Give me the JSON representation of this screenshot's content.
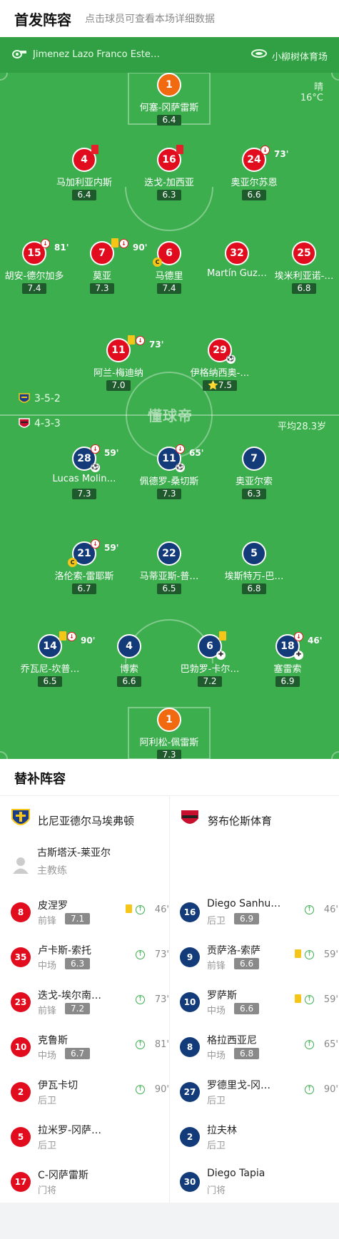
{
  "header": {
    "title": "首发阵容",
    "subtitle": "点击球员可查看本场详细数据"
  },
  "match": {
    "referee": "Jimenez Lazo Franco Este…",
    "venue": "小柳树体育场",
    "weather": "晴",
    "temperature": "16°C"
  },
  "home": {
    "formation": "3-5-2",
    "players": [
      {
        "num": "1",
        "name": "何塞-冈萨雷斯",
        "rating": "6.4"
      },
      {
        "num": "4",
        "name": "马加利亚内斯",
        "rating": "6.4"
      },
      {
        "num": "16",
        "name": "迭戈-加西亚",
        "rating": "6.3"
      },
      {
        "num": "24",
        "name": "奥亚尔苏恩",
        "rating": "6.6",
        "sub_time": "73'"
      },
      {
        "num": "15",
        "name": "胡安-德尔加多",
        "rating": "7.4",
        "sub_time": "81'"
      },
      {
        "num": "7",
        "name": "莫亚",
        "rating": "7.3",
        "sub_time": "90'"
      },
      {
        "num": "6",
        "name": "马德里",
        "rating": "7.4",
        "captain": "C"
      },
      {
        "num": "32",
        "name": "Martín Guz…",
        "rating": ""
      },
      {
        "num": "25",
        "name": "埃米利亚诺-…",
        "rating": "6.8"
      },
      {
        "num": "11",
        "name": "阿兰-梅迪纳",
        "rating": "7.0",
        "sub_time": "73'"
      },
      {
        "num": "29",
        "name": "伊格纳西奥-…",
        "rating": "7.5"
      }
    ]
  },
  "away": {
    "formation": "4-3-3",
    "avg_age": "平均28.3岁",
    "players": [
      {
        "num": "28",
        "name": "Lucas Molin…",
        "rating": "7.3",
        "sub_time": "59'"
      },
      {
        "num": "11",
        "name": "佩德罗-桑切斯",
        "rating": "7.3",
        "sub_time": "65'"
      },
      {
        "num": "7",
        "name": "奥亚尔索",
        "rating": "6.3"
      },
      {
        "num": "21",
        "name": "洛伦索-雷耶斯",
        "rating": "6.7",
        "sub_time": "59'",
        "captain": "C"
      },
      {
        "num": "22",
        "name": "马蒂亚斯-普…",
        "rating": "6.5"
      },
      {
        "num": "5",
        "name": "埃斯特万-巴…",
        "rating": "6.8"
      },
      {
        "num": "14",
        "name": "乔瓦尼-坎普…",
        "rating": "6.5",
        "sub_time": "90'"
      },
      {
        "num": "4",
        "name": "博索",
        "rating": "6.6"
      },
      {
        "num": "6",
        "name": "巴勃罗-卡尔…",
        "rating": "7.2"
      },
      {
        "num": "18",
        "name": "塞雷索",
        "rating": "6.9",
        "sub_time": "46'"
      },
      {
        "num": "1",
        "name": "阿利松-佩雷斯",
        "rating": "7.3"
      }
    ]
  },
  "watermark": "懂球帝",
  "subs": {
    "title": "替补阵容",
    "home_team": "比尼亚德尔马埃弗顿",
    "away_team": "努布伦斯体育",
    "coach": {
      "name": "古斯塔沃-莱亚尔",
      "role": "主教练"
    },
    "home": [
      {
        "num": "8",
        "name": "皮涅罗",
        "pos": "前锋",
        "rating": "7.1",
        "time": "46'"
      },
      {
        "num": "35",
        "name": "卢卡斯-索托",
        "pos": "中场",
        "rating": "6.3",
        "time": "73'"
      },
      {
        "num": "23",
        "name": "迭戈-埃尔南…",
        "pos": "前锋",
        "rating": "7.2",
        "time": "73'"
      },
      {
        "num": "10",
        "name": "克鲁斯",
        "pos": "中场",
        "rating": "6.7",
        "time": "81'"
      },
      {
        "num": "2",
        "name": "伊瓦卡切",
        "pos": "后卫",
        "rating": "",
        "time": "90'"
      },
      {
        "num": "5",
        "name": "拉米罗-冈萨…",
        "pos": "后卫",
        "rating": "",
        "time": ""
      },
      {
        "num": "17",
        "name": "C-冈萨雷斯",
        "pos": "门将",
        "rating": "",
        "time": ""
      }
    ],
    "away": [
      {
        "num": "16",
        "name": "Diego Sanhu…",
        "pos": "后卫",
        "rating": "6.9",
        "time": "46'"
      },
      {
        "num": "9",
        "name": "贡萨洛-索萨",
        "pos": "前锋",
        "rating": "6.6",
        "time": "59'"
      },
      {
        "num": "10",
        "name": "罗萨斯",
        "pos": "中场",
        "rating": "6.6",
        "time": "59'"
      },
      {
        "num": "8",
        "name": "格拉西亚尼",
        "pos": "中场",
        "rating": "6.8",
        "time": "65'"
      },
      {
        "num": "27",
        "name": "罗德里戈-冈…",
        "pos": "后卫",
        "rating": "",
        "time": "90'"
      },
      {
        "num": "2",
        "name": "拉夫林",
        "pos": "后卫",
        "rating": "",
        "time": ""
      },
      {
        "num": "30",
        "name": "Diego Tapia",
        "pos": "门将",
        "rating": "",
        "time": ""
      }
    ]
  }
}
